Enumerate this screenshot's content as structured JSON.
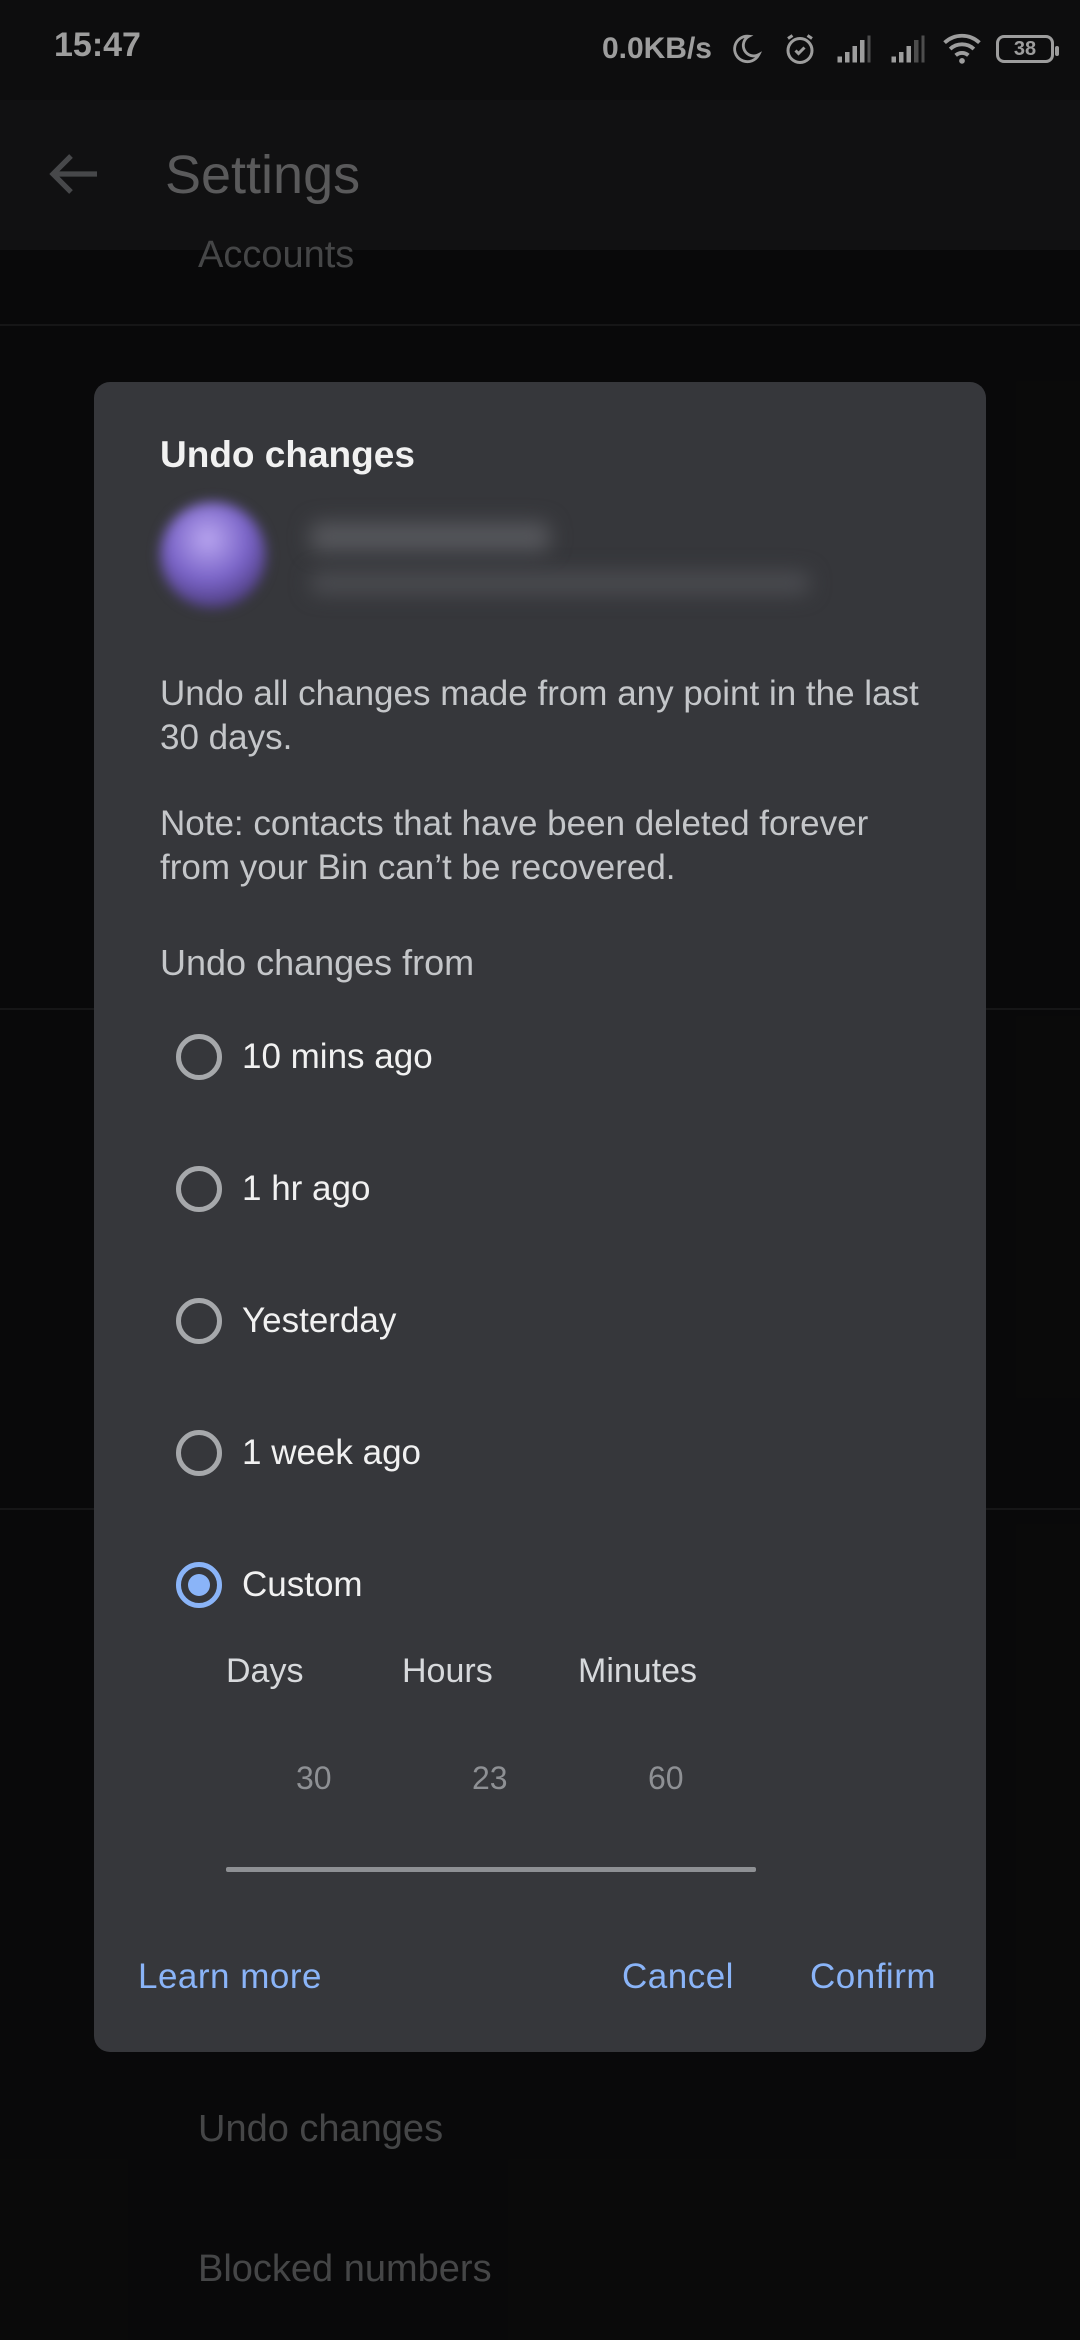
{
  "status_bar": {
    "time": "15:47",
    "net_speed": "0.0KB/s",
    "battery_level": "38",
    "icons": [
      "moon-icon",
      "alarm-icon",
      "signal-icon",
      "signal-icon",
      "wifi-icon",
      "battery-icon"
    ]
  },
  "app_bar": {
    "title": "Settings",
    "back_icon": "arrow-left-icon"
  },
  "background_list": {
    "items": [
      "Accounts",
      "Undo changes",
      "Blocked numbers"
    ]
  },
  "dialog": {
    "title": "Undo changes",
    "description": "Undo all changes made from any point in the last 30 days.",
    "note": "Note: contacts that have been deleted forever from your Bin can’t be recovered.",
    "section_label": "Undo changes from",
    "options": [
      {
        "label": "10 mins ago",
        "selected": false
      },
      {
        "label": "1 hr ago",
        "selected": false
      },
      {
        "label": "Yesterday",
        "selected": false
      },
      {
        "label": "1 week ago",
        "selected": false
      },
      {
        "label": "Custom",
        "selected": true
      }
    ],
    "custom_picker": {
      "headers": [
        "Days",
        "Hours",
        "Minutes"
      ],
      "values": [
        "30",
        "23",
        "60"
      ]
    },
    "buttons": {
      "learn_more": "Learn more",
      "cancel": "Cancel",
      "confirm": "Confirm"
    },
    "accent_color": "#8ab4f8"
  }
}
